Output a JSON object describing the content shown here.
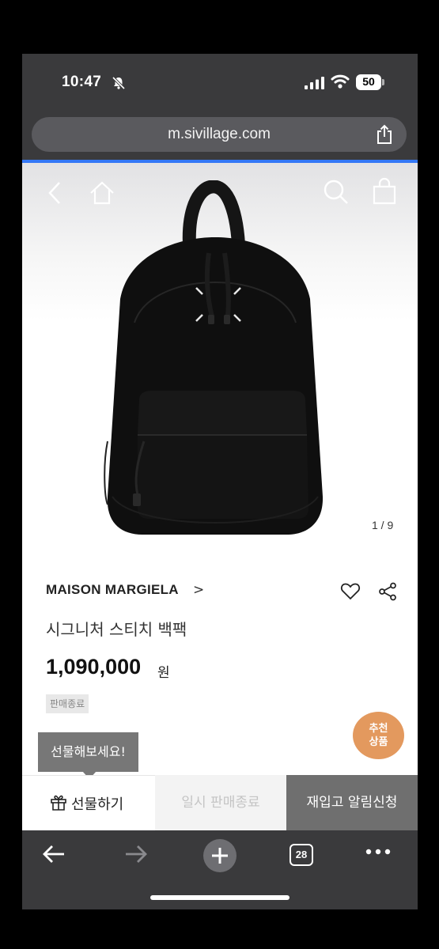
{
  "status": {
    "time": "10:47",
    "battery": "50"
  },
  "browser": {
    "url": "m.sivillage.com",
    "tab_count": "28"
  },
  "gallery": {
    "pager": "1 / 9"
  },
  "product": {
    "brand": "MAISON MARGIELA",
    "brand_arrow": ">",
    "name": "시그니처 스티치 백팩",
    "price": "1,090,000",
    "currency": "원",
    "badge": "판매종료"
  },
  "recommend": {
    "line1": "추천",
    "line2": "상품"
  },
  "tooltip": "선물해보세요!",
  "actions": {
    "gift": "선물하기",
    "sold_out": "일시 판매종료",
    "notify": "재입고 알림신청"
  },
  "colors": {
    "accent": "#3478f6",
    "recommend": "#e3995e",
    "notify_bg": "#6f6f6f"
  }
}
